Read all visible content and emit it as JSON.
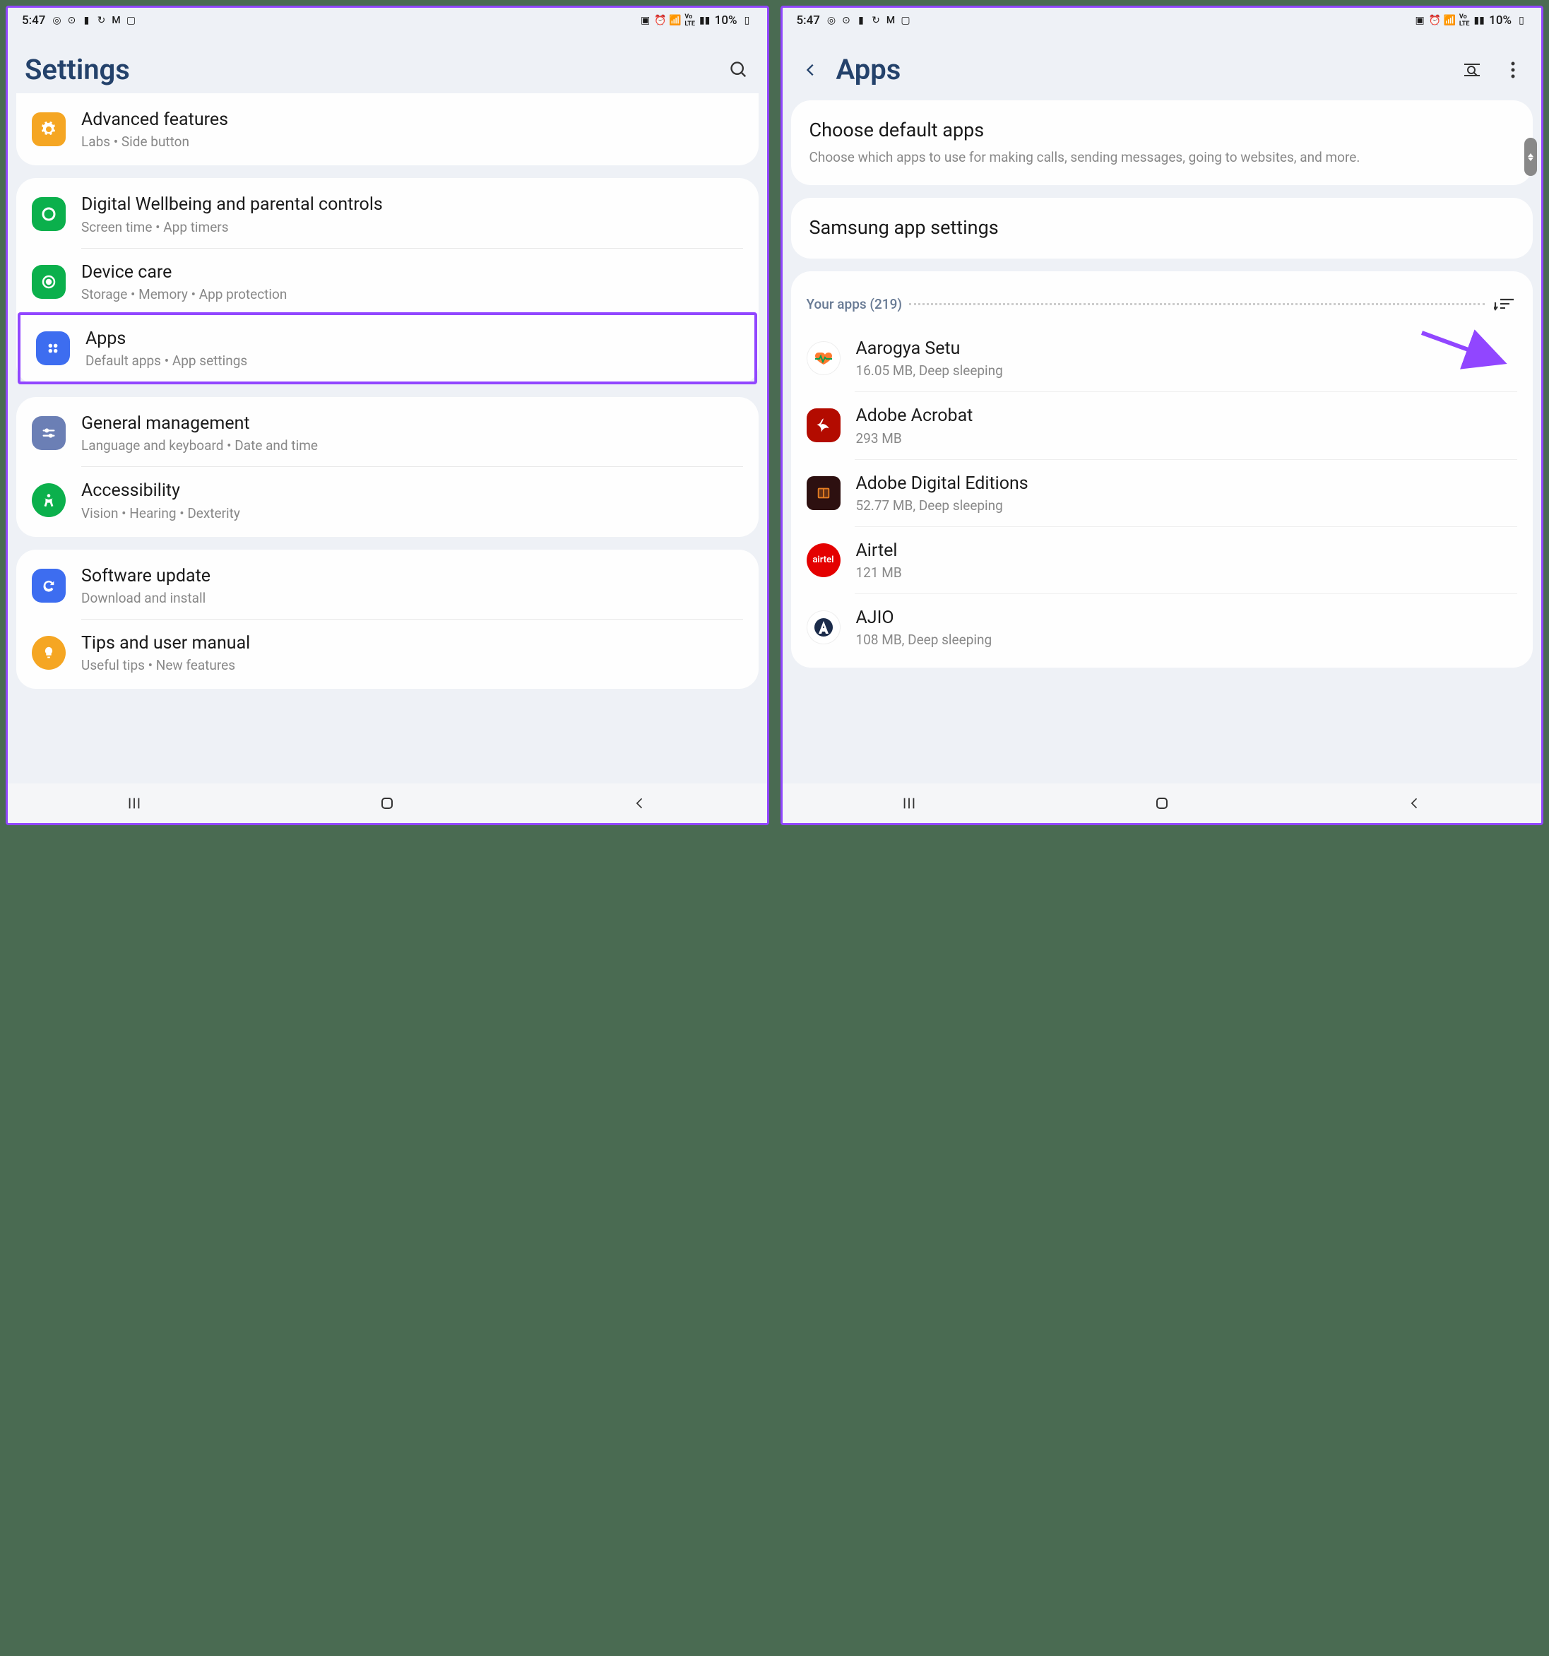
{
  "status": {
    "time": "5:47",
    "battery": "10%"
  },
  "left": {
    "title": "Settings",
    "items": [
      {
        "icon": "gear",
        "color": "#f5a623",
        "title": "Advanced features",
        "subtitle": "Labs  •  Side button"
      },
      {
        "icon": "wellbeing",
        "color": "#0bb04c",
        "title": "Digital Wellbeing and parental controls",
        "subtitle": "Screen time  •  App timers"
      },
      {
        "icon": "devicecare",
        "color": "#0bb04c",
        "title": "Device care",
        "subtitle": "Storage  •  Memory  •  App protection"
      },
      {
        "icon": "apps",
        "color": "#3d6df0",
        "title": "Apps",
        "subtitle": "Default apps  •  App settings",
        "highlight": true
      },
      {
        "icon": "sliders",
        "color": "#6b7fb5",
        "title": "General management",
        "subtitle": "Language and keyboard  •  Date and time"
      },
      {
        "icon": "accessibility",
        "color": "#0bb04c",
        "title": "Accessibility",
        "subtitle": "Vision  •  Hearing  •  Dexterity"
      },
      {
        "icon": "update",
        "color": "#3d6df0",
        "title": "Software update",
        "subtitle": "Download and install"
      },
      {
        "icon": "tips",
        "color": "#f5a623",
        "title": "Tips and user manual",
        "subtitle": "Useful tips  •  New features"
      }
    ]
  },
  "right": {
    "title": "Apps",
    "default_apps_title": "Choose default apps",
    "default_apps_sub": "Choose which apps to use for making calls, sending messages, going to websites, and more.",
    "samsung_settings": "Samsung app settings",
    "your_apps_label": "Your apps (219)",
    "apps": [
      {
        "name": "Aarogya Setu",
        "sub": "16.05 MB, Deep sleeping",
        "color": "#fff",
        "iconText": "❤"
      },
      {
        "name": "Adobe Acrobat",
        "sub": "293 MB",
        "color": "#b30b00",
        "iconText": "A"
      },
      {
        "name": "Adobe Digital Editions",
        "sub": "52.77 MB, Deep sleeping",
        "color": "#2d1010",
        "iconText": "▭"
      },
      {
        "name": "Airtel",
        "sub": "121 MB",
        "color": "#e40000",
        "iconText": "a"
      },
      {
        "name": "AJIO",
        "sub": "108 MB, Deep sleeping",
        "color": "#fff",
        "iconText": "A"
      }
    ]
  }
}
